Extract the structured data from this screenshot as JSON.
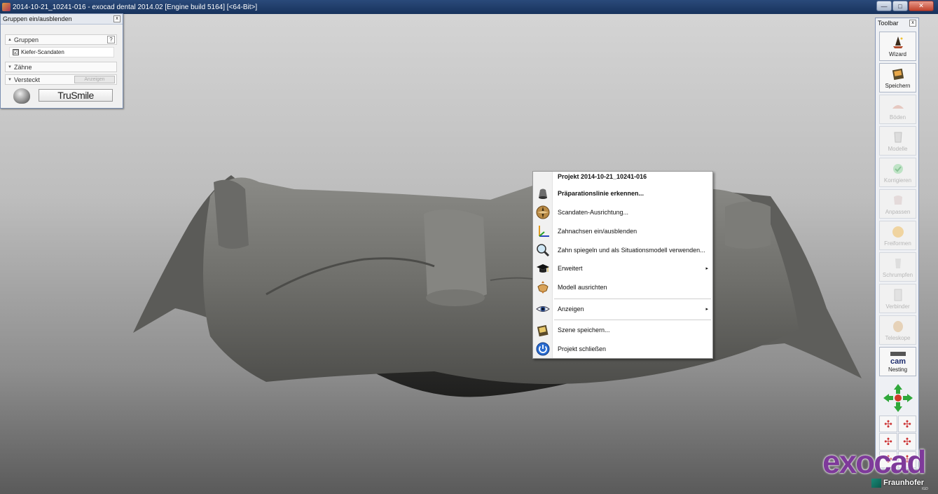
{
  "window": {
    "title": "2014-10-21_10241-016 - exocad dental 2014.02 [Engine build 5164] [<64-Bit>]",
    "buttons": {
      "minimize": "—",
      "maximize": "□",
      "close": "✕"
    }
  },
  "groups_panel": {
    "title": "Gruppen ein/ausblenden",
    "close": "x",
    "sections": {
      "gruppen": {
        "label": "Gruppen",
        "help": "?"
      },
      "kiefer": {
        "label": "Kiefer-Scandaten",
        "checked": "☑"
      },
      "zaehne": {
        "label": "Zähne"
      },
      "versteckt": {
        "label": "Versteckt",
        "show_button": "Anzeigen"
      }
    },
    "trusmile_label": "TruSmile"
  },
  "context_menu": {
    "header": "Projekt 2014-10-21_10241-016",
    "items": [
      {
        "label": "Präparationslinie erkennen...",
        "icon": "preparation-line-icon",
        "bold": true
      },
      {
        "label": "Scandaten-Ausrichtung...",
        "icon": "compass-icon"
      },
      {
        "label": "Zahnachsen ein/ausblenden",
        "icon": "axes-icon"
      },
      {
        "label": "Zahn spiegeln und als Situationsmodell verwenden...",
        "icon": "mirror-magnifier-icon"
      },
      {
        "label": "Erweitert",
        "icon": "graduation-cap-icon",
        "submenu": "▸"
      },
      {
        "label": "Modell ausrichten",
        "icon": "align-model-icon"
      },
      {
        "label": "Anzeigen",
        "icon": "eye-icon",
        "submenu": "▸"
      },
      {
        "label": "Szene speichern...",
        "icon": "save-scene-icon"
      },
      {
        "label": "Projekt schließen",
        "icon": "power-icon"
      }
    ]
  },
  "toolbar": {
    "title": "Toolbar",
    "close": "x",
    "buttons": [
      {
        "label": "Wizard",
        "icon": "wizard-icon",
        "enabled": true
      },
      {
        "label": "Speichern",
        "icon": "save-book-icon",
        "enabled": true
      },
      {
        "label": "Böden",
        "icon": "base-icon",
        "enabled": false
      },
      {
        "label": "Modelle",
        "icon": "model-icon",
        "enabled": false
      },
      {
        "label": "Korrigieren",
        "icon": "correct-icon",
        "enabled": false
      },
      {
        "label": "Anpassen",
        "icon": "adjust-icon",
        "enabled": false
      },
      {
        "label": "Freiformen",
        "icon": "freeform-icon",
        "enabled": false
      },
      {
        "label": "Schrumpfen",
        "icon": "shrink-icon",
        "enabled": false
      },
      {
        "label": "Verbinder",
        "icon": "connector-icon",
        "enabled": false
      },
      {
        "label": "Teleskope",
        "icon": "telescope-icon",
        "enabled": false
      },
      {
        "label": "Nesting",
        "icon": "cam-icon",
        "enabled": true,
        "icon_text": "cam"
      }
    ]
  },
  "logos": {
    "exocad": "exocad",
    "fraunhofer": "Fraunhofer",
    "fraunhofer_sub": "IGD"
  },
  "colors": {
    "accent_purple": "#7e3a9a",
    "titlebar": "#17325c",
    "scan_gray": "#6e6e6b"
  }
}
